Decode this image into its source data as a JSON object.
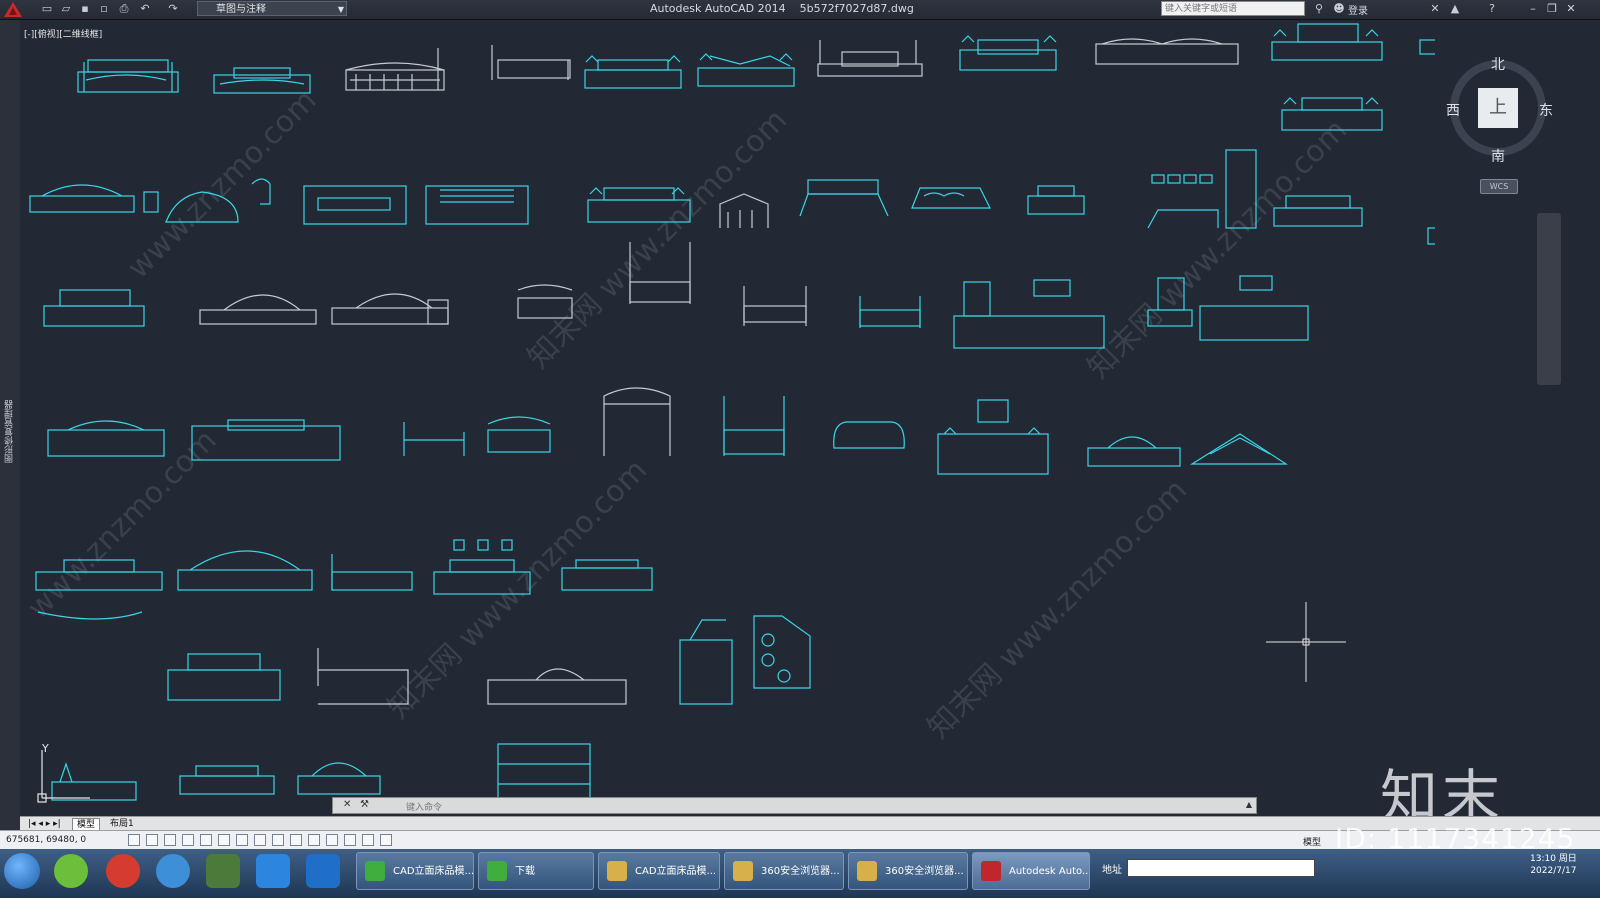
{
  "titlebar": {
    "workspace": "草图与注释",
    "app_title": "Autodesk AutoCAD 2014",
    "file_name": "5b572f7027d87.dwg",
    "search_placeholder": "键入关键字或短语",
    "login": "登录"
  },
  "viewport": {
    "label": "[-][俯视][二维线框]",
    "compass": {
      "north": "北",
      "south": "南",
      "east": "东",
      "west": "西",
      "top": "上"
    },
    "wcs": "WCS"
  },
  "left_palette": {
    "label": "图形修复管理器"
  },
  "command_line": {
    "placeholder": "键入命令"
  },
  "watermark": {
    "logo": "知末",
    "id": "ID: 1117341245"
  },
  "tabs": {
    "model": "模型",
    "layout1": "布局1"
  },
  "status": {
    "coords": "675681, 69480, 0",
    "model": "模型"
  },
  "taskbar": {
    "items": [
      {
        "label": "CAD立面床品模...",
        "color": "#3fae3f"
      },
      {
        "label": "下载",
        "color": "#3fae3f"
      },
      {
        "label": "CAD立面床品模...",
        "color": "#d8b04a"
      },
      {
        "label": "360安全浏览器...",
        "color": "#d8b04a"
      },
      {
        "label": "360安全浏览器...",
        "color": "#d8b04a"
      },
      {
        "label": "Autodesk Auto...",
        "color": "#c0262c"
      }
    ],
    "address_label": "地址",
    "clock_time": "13:10 周日",
    "clock_date": "2022/7/17"
  },
  "colors": {
    "cad_line": "#3ad6e6",
    "cad_gray": "#c8ccd2",
    "background": "#222834"
  }
}
